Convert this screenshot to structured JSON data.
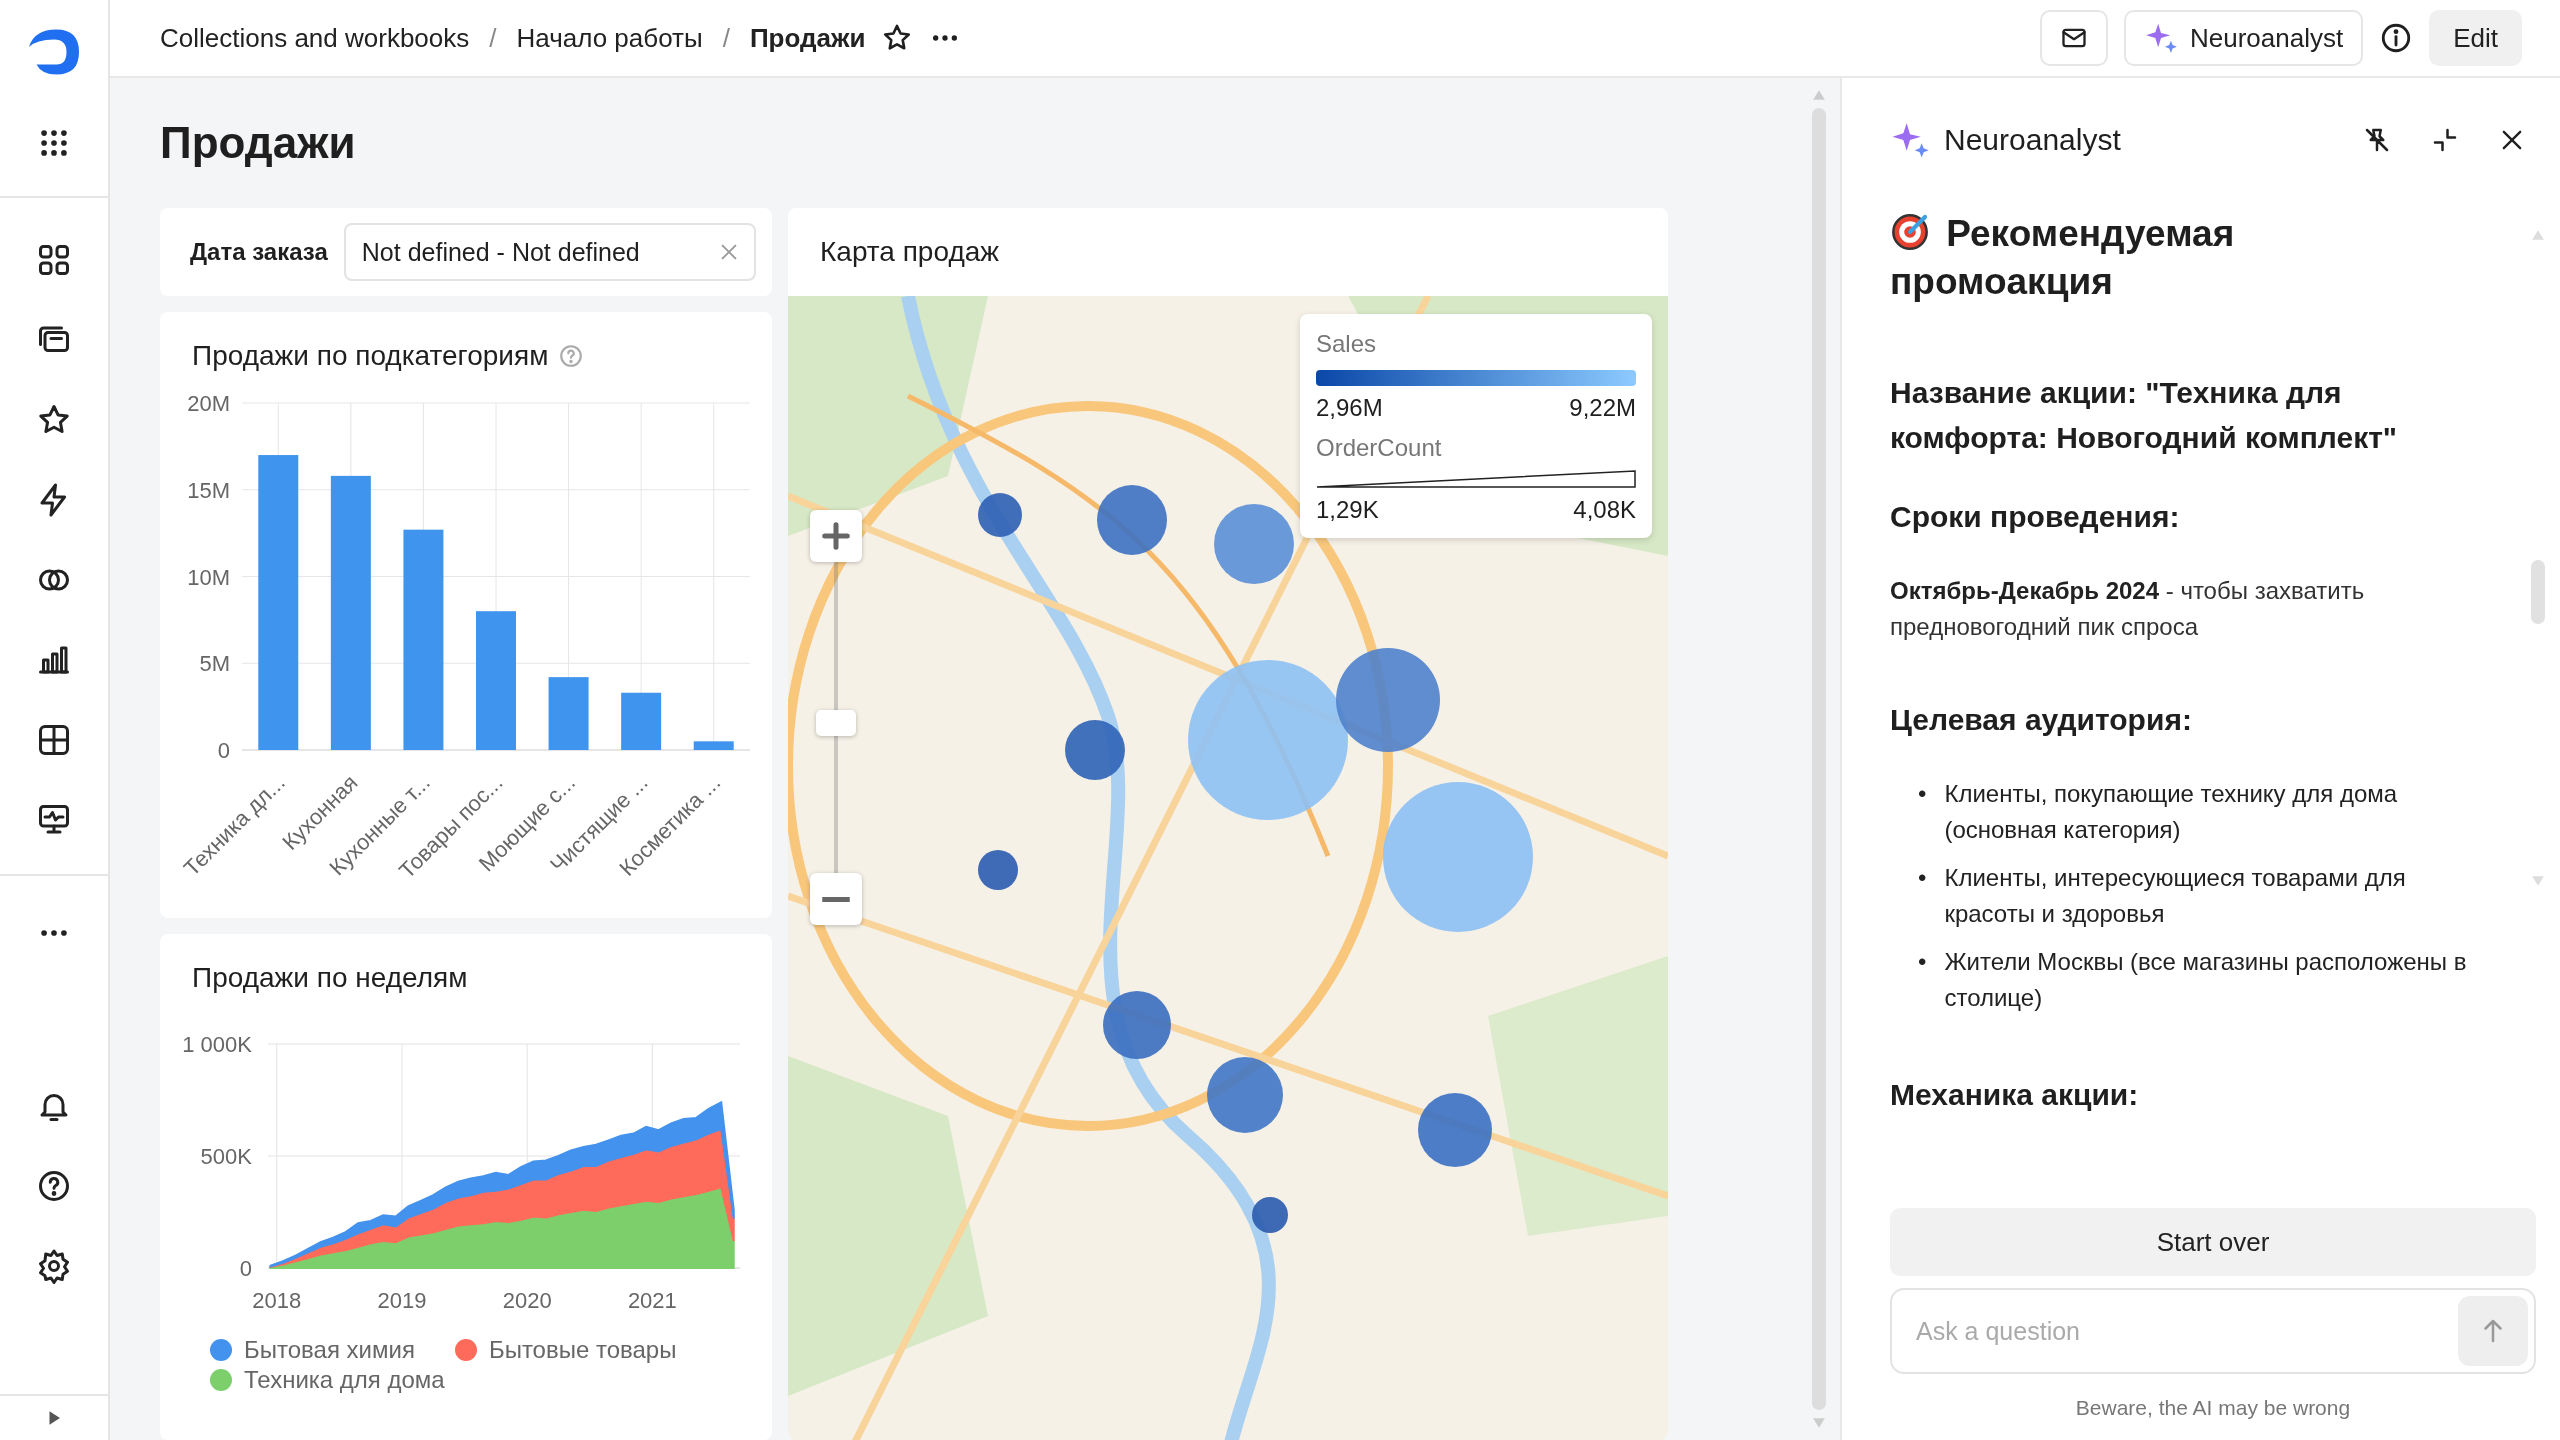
{
  "header": {
    "breadcrumbs": [
      {
        "label": "Collections and workbooks",
        "current": false
      },
      {
        "label": "Начало работы",
        "current": false,
        "separator": "/"
      },
      {
        "label": "Продажи",
        "current": true,
        "separator": "/"
      }
    ],
    "assistant_button": "Neuroanalyst",
    "edit_button": "Edit"
  },
  "page": {
    "title": "Продажи"
  },
  "filter": {
    "label": "Дата заказа",
    "value": "Not defined - Not defined"
  },
  "bar_widget": {
    "title": "Продажи по подкатегориям",
    "chart_data": {
      "type": "bar",
      "categories": [
        "Техника дл...",
        "Кухонная",
        "Кухонные т...",
        "Товары пос...",
        "Моющие с...",
        "Чистящие ...",
        "Косметика ..."
      ],
      "values": [
        17.0,
        15.8,
        12.7,
        8.0,
        4.2,
        3.3,
        0.5
      ],
      "grid": true,
      "ylim": [
        0,
        20
      ],
      "yticks": [
        {
          "value": 0,
          "label": "0"
        },
        {
          "value": 5,
          "label": "5M"
        },
        {
          "value": 10,
          "label": "10M"
        },
        {
          "value": 15,
          "label": "15M"
        },
        {
          "value": 20,
          "label": "20M"
        }
      ]
    }
  },
  "weekly_widget": {
    "title": "Продажи по неделям",
    "chart_data": {
      "type": "area",
      "stacked": true,
      "x": [
        2017.95,
        2018.05,
        2018.15,
        2018.25,
        2018.35,
        2018.45,
        2018.55,
        2018.65,
        2018.75,
        2018.85,
        2018.95,
        2019.05,
        2019.15,
        2019.25,
        2019.35,
        2019.45,
        2019.55,
        2019.65,
        2019.75,
        2019.85,
        2019.95,
        2020.05,
        2020.15,
        2020.25,
        2020.35,
        2020.45,
        2020.55,
        2020.65,
        2020.75,
        2020.85,
        2020.95,
        2021.05,
        2021.15,
        2021.25,
        2021.35,
        2021.45,
        2021.55,
        2021.65
      ],
      "series": [
        {
          "name": "Бытовая химия",
          "color": "#4392ee",
          "values": [
            3,
            7,
            10,
            15,
            20,
            25,
            30,
            45,
            35,
            40,
            45,
            50,
            55,
            60,
            65,
            70,
            75,
            70,
            80,
            60,
            75,
            80,
            85,
            80,
            90,
            85,
            95,
            90,
            95,
            90,
            100,
            95,
            100,
            105,
            95,
            110,
            120,
            40
          ]
        },
        {
          "name": "Бытовые товары",
          "color": "#ff6b5b",
          "values": [
            2,
            8,
            15,
            25,
            35,
            40,
            50,
            60,
            65,
            75,
            70,
            85,
            95,
            105,
            120,
            125,
            130,
            140,
            135,
            150,
            160,
            165,
            170,
            180,
            185,
            195,
            200,
            210,
            215,
            220,
            230,
            225,
            235,
            240,
            245,
            255,
            260,
            100
          ]
        },
        {
          "name": "Техника для дома",
          "color": "#7ccf6b",
          "values": [
            5,
            15,
            30,
            45,
            60,
            70,
            80,
            95,
            110,
            120,
            115,
            140,
            150,
            160,
            175,
            190,
            195,
            200,
            210,
            205,
            215,
            230,
            225,
            240,
            250,
            260,
            255,
            270,
            280,
            290,
            300,
            295,
            310,
            320,
            330,
            345,
            360,
            120
          ]
        }
      ],
      "grid": true,
      "xlim": [
        2017.93,
        2021.7
      ],
      "ylim": [
        0,
        1000
      ],
      "xticks": [
        2018,
        2019,
        2020,
        2021
      ],
      "yticks": [
        {
          "value": 0,
          "label": "0"
        },
        {
          "value": 500,
          "label": "500K"
        },
        {
          "value": 1000,
          "label": "1 000K"
        }
      ]
    }
  },
  "map_widget": {
    "title": "Карта продаж",
    "legend": {
      "color_title": "Sales",
      "color_min": "2,96M",
      "color_max": "9,22M",
      "size_title": "OrderCount",
      "size_min": "1,29K",
      "size_max": "4,08K"
    },
    "zoom": {
      "level": 0.48
    }
  },
  "assistant_panel": {
    "title": "Neuroanalyst",
    "blocks": [
      {
        "kind": "title",
        "text": "Рекомендуемая промоакция"
      },
      {
        "kind": "heading",
        "text": "Название акции: \"Техника для комфорта: Новогодний комплект\""
      },
      {
        "kind": "heading",
        "text": "Сроки проведения:"
      },
      {
        "kind": "paragraph",
        "text": "**Октябрь-Декабрь 2024** - чтобы захватить предновогодний пик спроса"
      },
      {
        "kind": "heading",
        "text": "Целевая аудитория:"
      },
      {
        "kind": "list",
        "items": [
          {
            "marker": "•",
            "text": "Клиенты, покупающие технику для дома (основная категория)"
          },
          {
            "marker": "•",
            "text": "Клиенты, интересующиеся товарами для красоты и здоровья"
          },
          {
            "marker": "•",
            "text": "Жители Москвы (все магазины расположены в столице)"
          }
        ]
      },
      {
        "kind": "heading",
        "text": "Механика акции:"
      }
    ],
    "start_over": "Start over",
    "input": {
      "placeholder": "Ask a question"
    },
    "disclaimer": "Beware, the AI may be wrong"
  }
}
